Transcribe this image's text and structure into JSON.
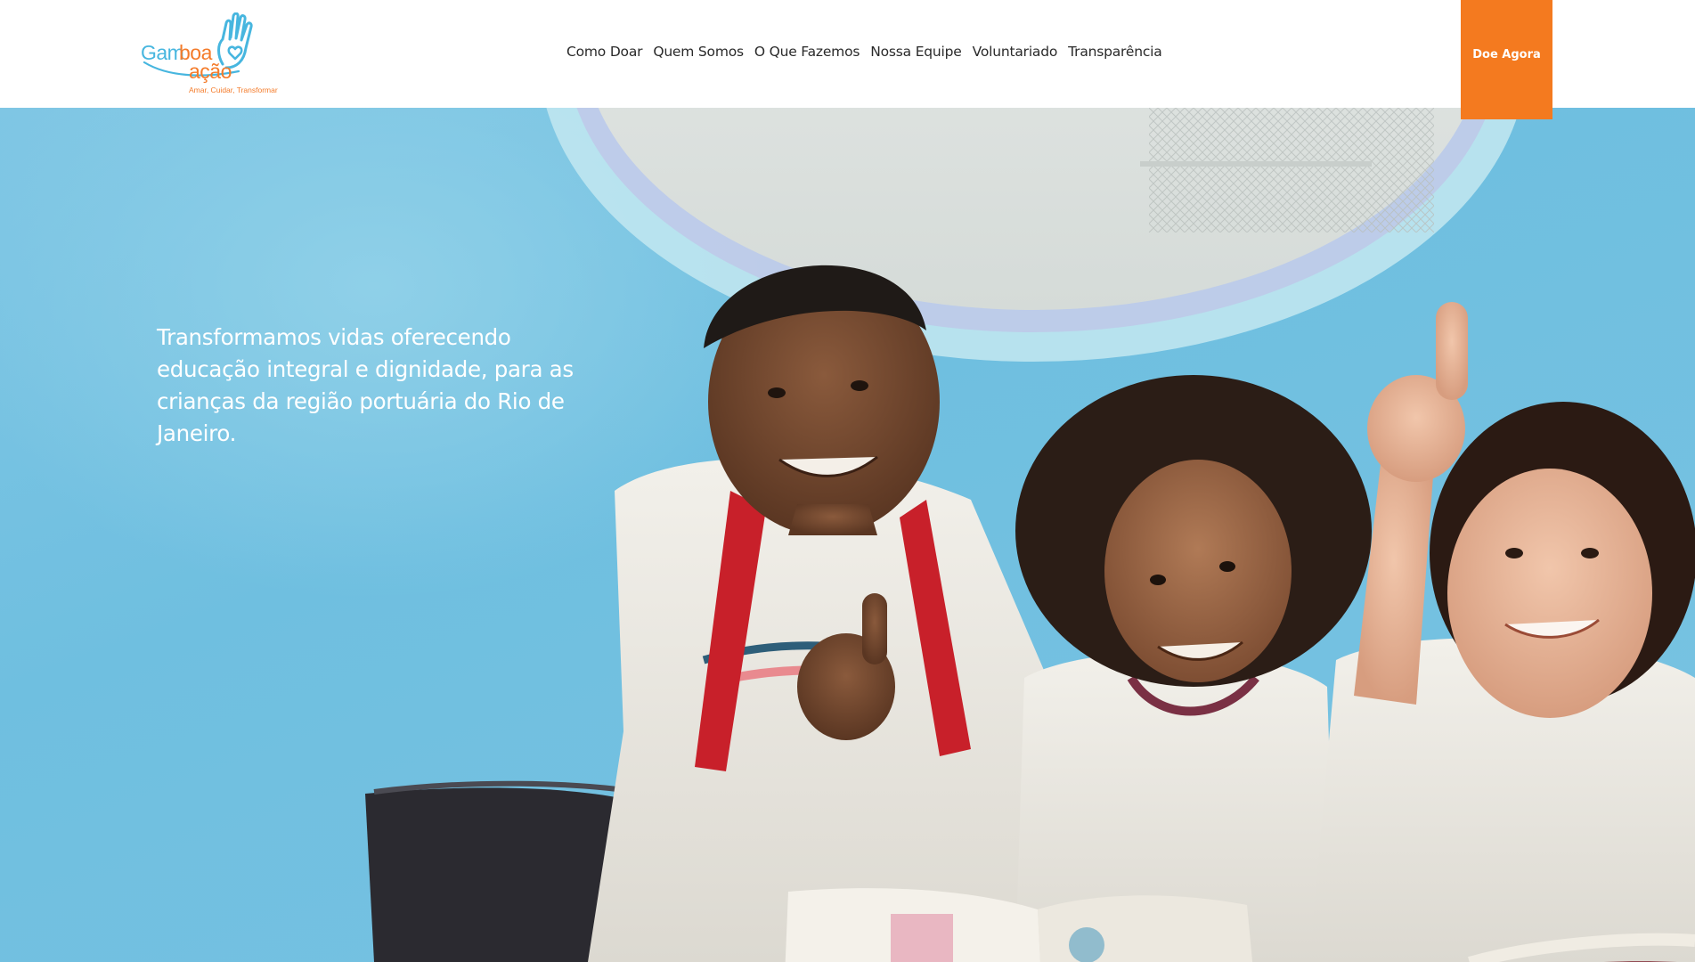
{
  "logo": {
    "word_part1": "Gam",
    "word_part2": "boa",
    "word_part3": "ação",
    "tagline": "Amar, Cuidar, Transformar",
    "icon": "hand-heart-icon",
    "colors": {
      "blue": "#47b6df",
      "orange": "#f47b2a"
    }
  },
  "nav": {
    "items": [
      {
        "label": "Como Doar"
      },
      {
        "label": "Quem Somos"
      },
      {
        "label": "O Que Fazemos"
      },
      {
        "label": "Nossa Equipe"
      },
      {
        "label": "Voluntariado"
      },
      {
        "label": "Transparência"
      }
    ]
  },
  "cta": {
    "label": "Doe Agora",
    "color": "#f47a1f"
  },
  "hero": {
    "headline": "Transformamos vidas oferecendo educação integral e dignidade, para as crianças da região portuária do Rio de Janeiro.",
    "image": "children-reading-photo",
    "background_color": "#74c2e2"
  }
}
